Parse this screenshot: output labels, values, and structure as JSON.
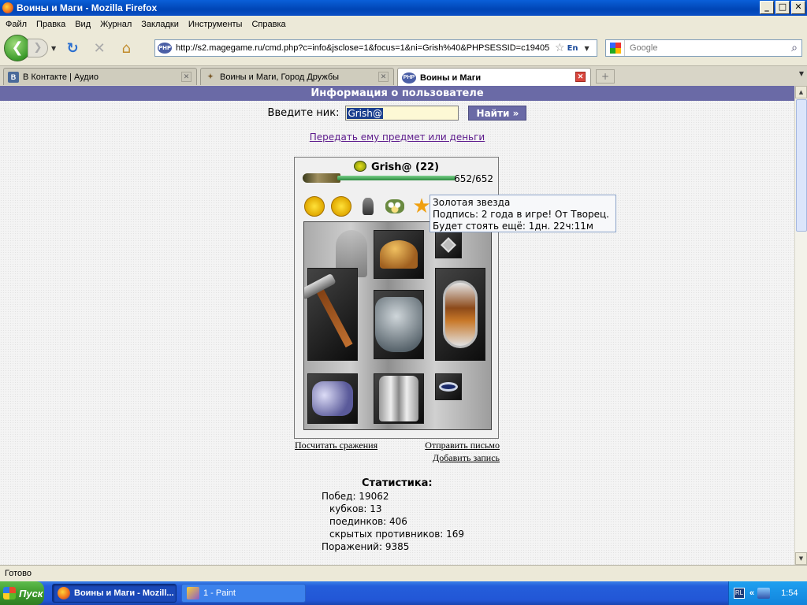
{
  "window": {
    "title": "Воины и Маги - Mozilla Firefox",
    "min": "_",
    "max": "□",
    "close": "✕"
  },
  "menu": [
    "Файл",
    "Правка",
    "Вид",
    "Журнал",
    "Закладки",
    "Инструменты",
    "Справка"
  ],
  "nav": {
    "url": "http://s2.magegame.ru/cmd.php?c=info&jsclose=1&focus=1&ni=Grish%40&PHPSESSID=c19405",
    "lang": "En",
    "search_placeholder": "Google"
  },
  "tabs": [
    {
      "label": "В Контакте | Аудио",
      "icon": "В",
      "active": false
    },
    {
      "label": "Воины и Маги, Город Дружбы",
      "icon": "",
      "active": false
    },
    {
      "label": "Воины и Маги",
      "icon": "PHP",
      "active": true
    }
  ],
  "page": {
    "banner": "Информация о пользователе",
    "nick_label": "Введите ник:",
    "nick_value": "Grish@",
    "find_button": "Найти »",
    "transfer_link": "Передать ему предмет или деньги",
    "character": {
      "name": "Grish@ (22)",
      "hp": "652/652",
      "hp_fraction": 1.0
    },
    "tooltip": {
      "line1": "Золотая звезда",
      "line2": "Подпись: 2 года в игре! От Творец.",
      "line3": "Будет стоять ещё: 1дн. 22ч:11м"
    },
    "links": {
      "battles": "Посчитать сражения",
      "send_letter": "Отправить письмо",
      "add_record": "Добавить запись"
    },
    "stats": {
      "title": "Статистика:",
      "wins": "Побед: 19062",
      "cups": "кубков: 13",
      "duels": "поединков: 406",
      "hidden": "скрытых противников: 169",
      "losses": "Поражений: 9385"
    }
  },
  "status": "Готово",
  "taskbar": {
    "start": "Пуск",
    "items": [
      "Воины и Маги - Mozill...",
      "1 - Paint"
    ],
    "tray_lang": "RL",
    "clock": "1:54"
  }
}
